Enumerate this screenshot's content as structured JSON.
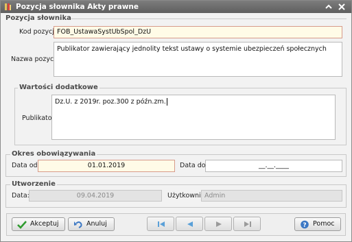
{
  "window": {
    "title": "Pozycja słownika Akty prawne"
  },
  "titlebar": {
    "collapse_icon": "chevron-up-icon",
    "close_icon": "close-icon"
  },
  "slownik": {
    "heading": "Pozycja słownika",
    "kod_label": "Kod pozycji:",
    "kod_value": "FOB_UstawaSystUbSpol_DzU",
    "nazwa_label": "Nazwa pozycji:",
    "nazwa_value": "Publikator zawierający jednolity tekst ustawy o systemie ubezpieczeń społecznych"
  },
  "wartosci": {
    "heading": "Wartości dodatkowe",
    "publikator_label": "Publikator:",
    "publikator_value": "Dz.U. z 2019r. poz.300 z późn.zm."
  },
  "okres": {
    "heading": "Okres obowiązywania",
    "data_od_label": "Data od:",
    "data_od_value": "01.01.2019",
    "data_do_label": "Data do:",
    "data_do_value": "__.__.____"
  },
  "utworzenie": {
    "heading": "Utworzenie",
    "data_label": "Data:",
    "data_value": "09.04.2019",
    "uzytkownik_label": "Użytkownik:",
    "uzytkownik_value": "Admin"
  },
  "footer": {
    "accept_label": "Akceptuj",
    "cancel_label": "Anuluj",
    "help_label": "Pomoc",
    "nav_icons": [
      "first-record-icon",
      "previous-record-icon",
      "next-record-icon",
      "last-record-icon"
    ]
  },
  "colors": {
    "titlebar": "#6b6b6b",
    "required_field_bg": "#fffbe7",
    "required_field_border": "#d79a8a",
    "nav_blue": "#5aa0d8",
    "nav_disabled": "#9a9a9a"
  }
}
